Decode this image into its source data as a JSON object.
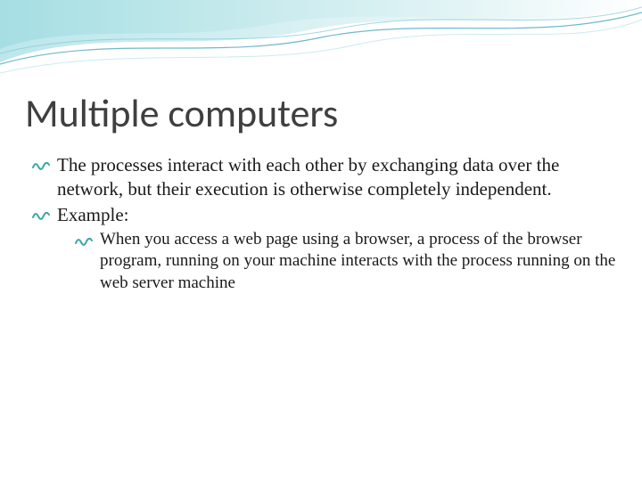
{
  "title": "Multiple computers",
  "bullets": [
    "The processes interact with each other by exchanging data over the network, but their execution is otherwise completely independent.",
    "Example:"
  ],
  "sub_bullets": [
    "When you access a web page using a browser, a process of the browser program, running on your machine interacts with the process running on the web server machine"
  ],
  "colors": {
    "wave_light": "#bfe8e8",
    "wave_mid": "#6fc9d6",
    "wave_line": "#4aa8bd",
    "bullet": "#3aa6a6"
  }
}
